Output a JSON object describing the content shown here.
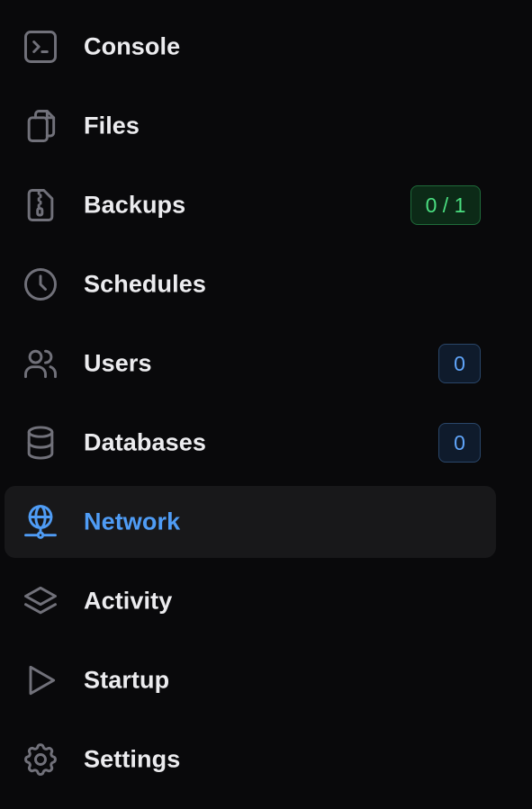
{
  "nav": {
    "items": [
      {
        "label": "Console",
        "icon": "terminal-icon"
      },
      {
        "label": "Files",
        "icon": "files-icon"
      },
      {
        "label": "Backups",
        "icon": "archive-icon",
        "badge": "0 / 1",
        "badge_color": "#4ade80"
      },
      {
        "label": "Schedules",
        "icon": "clock-icon"
      },
      {
        "label": "Users",
        "icon": "users-icon",
        "badge": "0",
        "badge_color": "#60a5fa"
      },
      {
        "label": "Databases",
        "icon": "database-icon",
        "badge": "0",
        "badge_color": "#60a5fa"
      },
      {
        "label": "Network",
        "icon": "network-icon",
        "active": true
      },
      {
        "label": "Activity",
        "icon": "layers-icon"
      },
      {
        "label": "Startup",
        "icon": "play-icon"
      },
      {
        "label": "Settings",
        "icon": "gear-icon"
      }
    ]
  },
  "colors": {
    "background": "#09090b",
    "active_background": "#18181a",
    "active_accent": "#4f9cf5",
    "icon_default": "#71717a",
    "label_default": "#ececef"
  }
}
